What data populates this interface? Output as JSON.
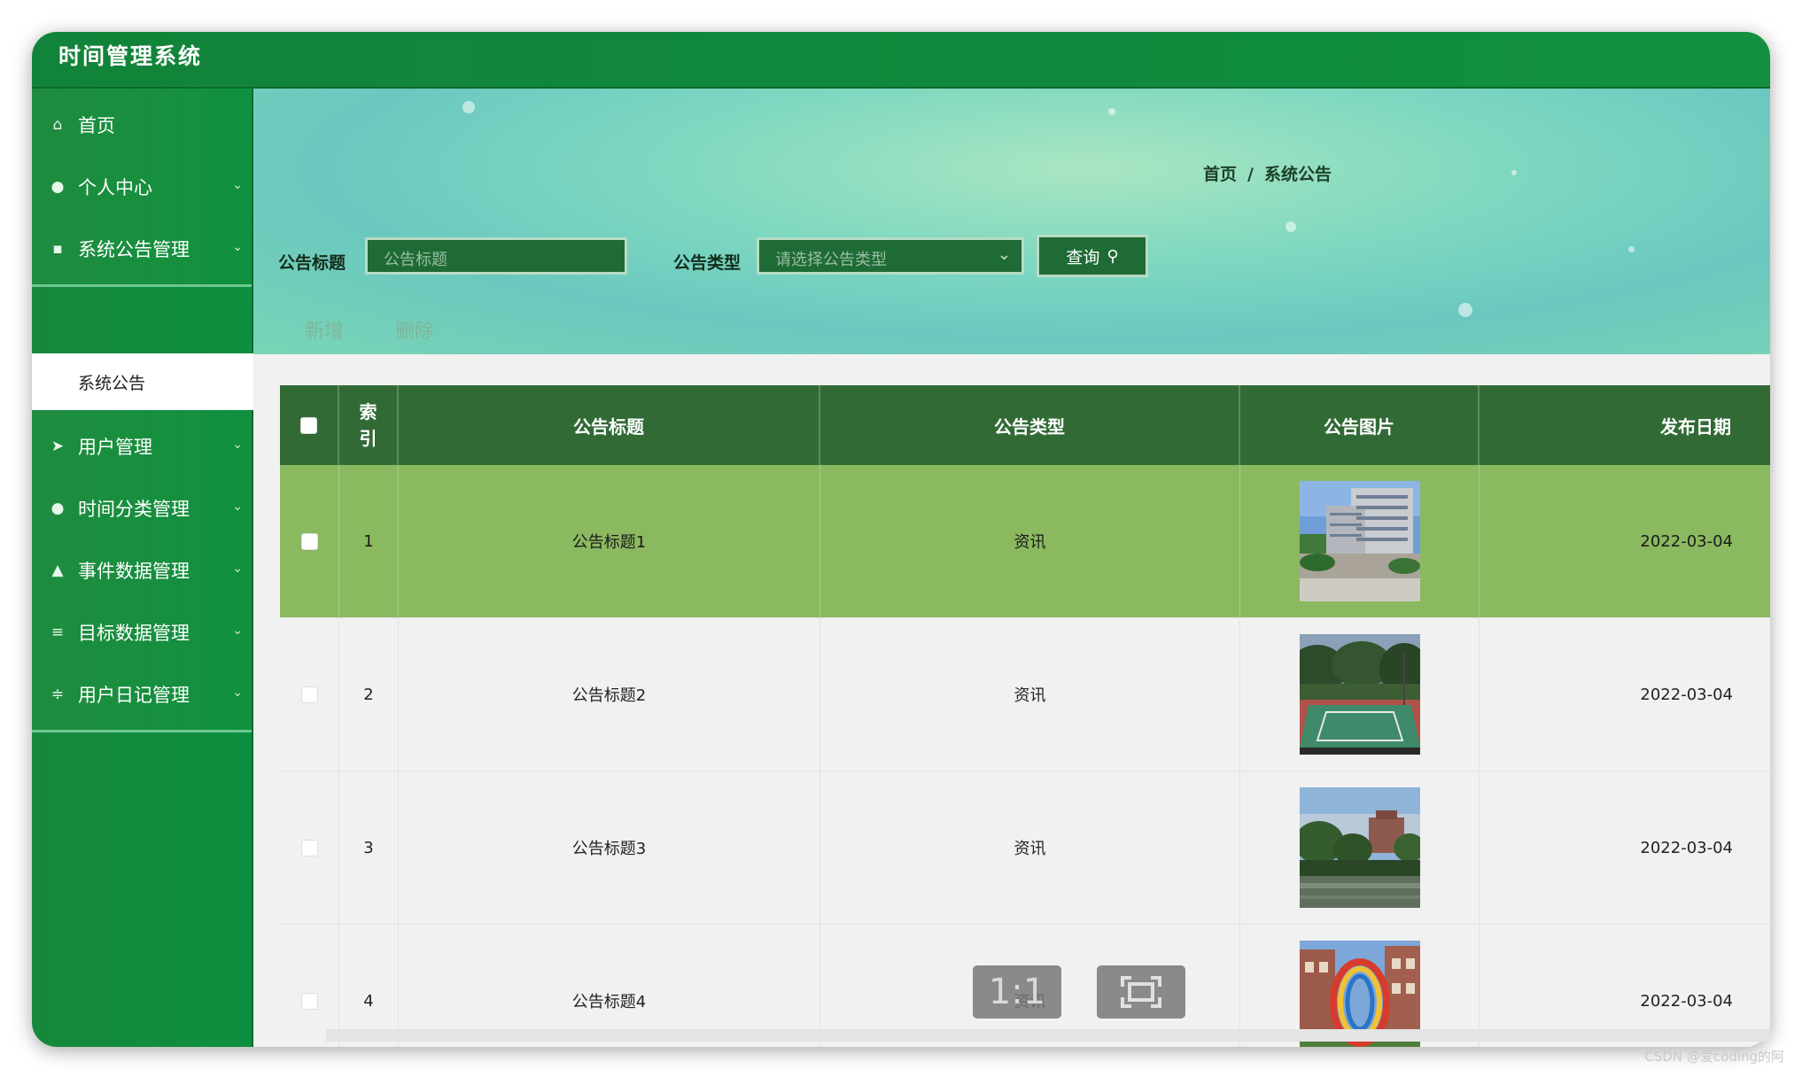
{
  "app": {
    "title": "时间管理系统"
  },
  "sidebar": {
    "items": [
      {
        "label": "首页",
        "icon": "home-icon",
        "glyph": "⌂",
        "expandable": false
      },
      {
        "label": "个人中心",
        "icon": "user-icon",
        "glyph": "●",
        "expandable": true
      },
      {
        "label": "系统公告管理",
        "icon": "grid-icon",
        "glyph": "▪",
        "expandable": true
      },
      {
        "label": "用户管理",
        "icon": "send-icon",
        "glyph": "➤",
        "expandable": true
      },
      {
        "label": "时间分类管理",
        "icon": "pin-icon",
        "glyph": "●",
        "expandable": true
      },
      {
        "label": "事件数据管理",
        "icon": "person-icon",
        "glyph": "▲",
        "expandable": true
      },
      {
        "label": "目标数据管理",
        "icon": "list-icon",
        "glyph": "≡",
        "expandable": true
      },
      {
        "label": "用户日记管理",
        "icon": "sliders-icon",
        "glyph": "≑",
        "expandable": true
      }
    ],
    "active_submenu": "系统公告",
    "arrow_glyph": "⌄"
  },
  "breadcrumb": {
    "home": "首页",
    "separator": "/",
    "current": "系统公告"
  },
  "search": {
    "title_label": "公告标题",
    "title_placeholder": "公告标题",
    "type_label": "公告类型",
    "type_placeholder": "请选择公告类型",
    "button_label": "查询",
    "button_icon": "search-icon"
  },
  "actions": {
    "add": "新增",
    "delete": "删除"
  },
  "table": {
    "headers": {
      "index": "索\n引",
      "title": "公告标题",
      "type": "公告类型",
      "image": "公告图片",
      "date": "发布日期"
    },
    "rows": [
      {
        "index": "1",
        "title": "公告标题1",
        "type": "资讯",
        "image": "campus-buildings-photo",
        "date": "2022-03-04",
        "highlighted": true
      },
      {
        "index": "2",
        "title": "公告标题2",
        "type": "资讯",
        "image": "basketball-court-photo",
        "date": "2022-03-04",
        "highlighted": false
      },
      {
        "index": "3",
        "title": "公告标题3",
        "type": "资讯",
        "image": "lake-building-photo",
        "date": "2022-03-04",
        "highlighted": false
      },
      {
        "index": "4",
        "title": "公告标题4",
        "type": "资讯",
        "image": "sculpture-photo",
        "date": "2022-03-04",
        "highlighted": false
      }
    ]
  },
  "viewer": {
    "actual_size": "1:1",
    "fit_icon": "fit-screen-icon"
  },
  "watermark": "CSDN @爱coding的阿"
}
